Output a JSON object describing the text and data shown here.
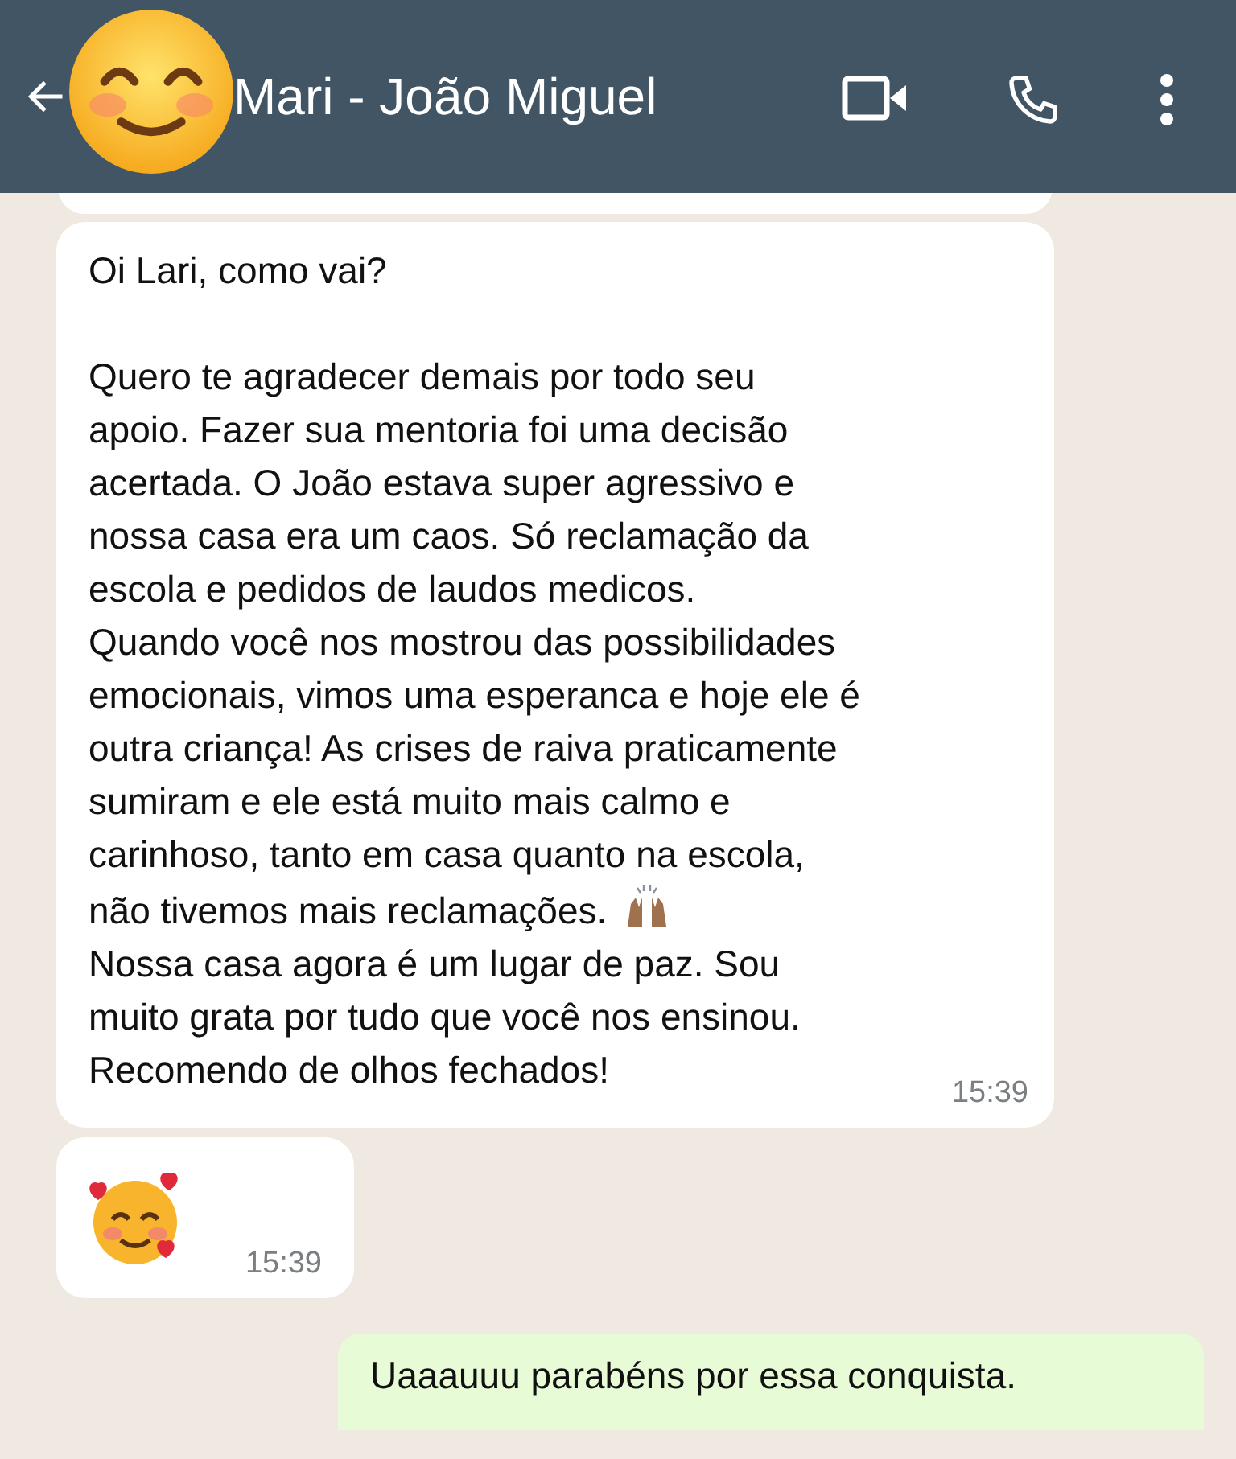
{
  "header": {
    "title": "Mari - João Miguel"
  },
  "messages": [
    {
      "kind": "received-text",
      "time": "15:39",
      "lines": [
        {
          "text": "Oi Lari, como vai?",
          "kind": "text"
        },
        {
          "kind": "blank"
        },
        {
          "text": "Quero te agradecer demais por todo seu",
          "kind": "text"
        },
        {
          "text": "apoio. Fazer sua mentoria foi uma decisão",
          "kind": "text"
        },
        {
          "text": "acertada. O João estava super agressivo e",
          "kind": "text"
        },
        {
          "text": "nossa casa era um caos. Só reclamação da",
          "kind": "text"
        },
        {
          "text": "escola e pedidos de laudos medicos.",
          "kind": "text"
        },
        {
          "text": "Quando você nos mostrou das possibilidades",
          "kind": "text"
        },
        {
          "text": "emocionais, vimos uma esperanca e hoje ele é",
          "kind": "text"
        },
        {
          "text": "outra criança! As crises de raiva praticamente",
          "kind": "text"
        },
        {
          "text": "sumiram e ele está muito mais calmo e",
          "kind": "text"
        },
        {
          "text": "carinhoso, tanto em casa quanto na escola,",
          "kind": "text"
        },
        {
          "text": "não tivemos mais reclamações.",
          "kind": "text-hands"
        },
        {
          "text": "Nossa casa agora é um lugar de paz. Sou",
          "kind": "text"
        },
        {
          "text": "muito grata por tudo que você nos ensinou.",
          "kind": "text"
        },
        {
          "text": "Recomendo de olhos fechados!",
          "kind": "text"
        }
      ]
    },
    {
      "kind": "received-emoji",
      "time": "15:39"
    },
    {
      "kind": "sent-text",
      "lines": [
        {
          "text": "Uaaauuu parabéns por essa conquista.",
          "kind": "text"
        }
      ]
    }
  ]
}
